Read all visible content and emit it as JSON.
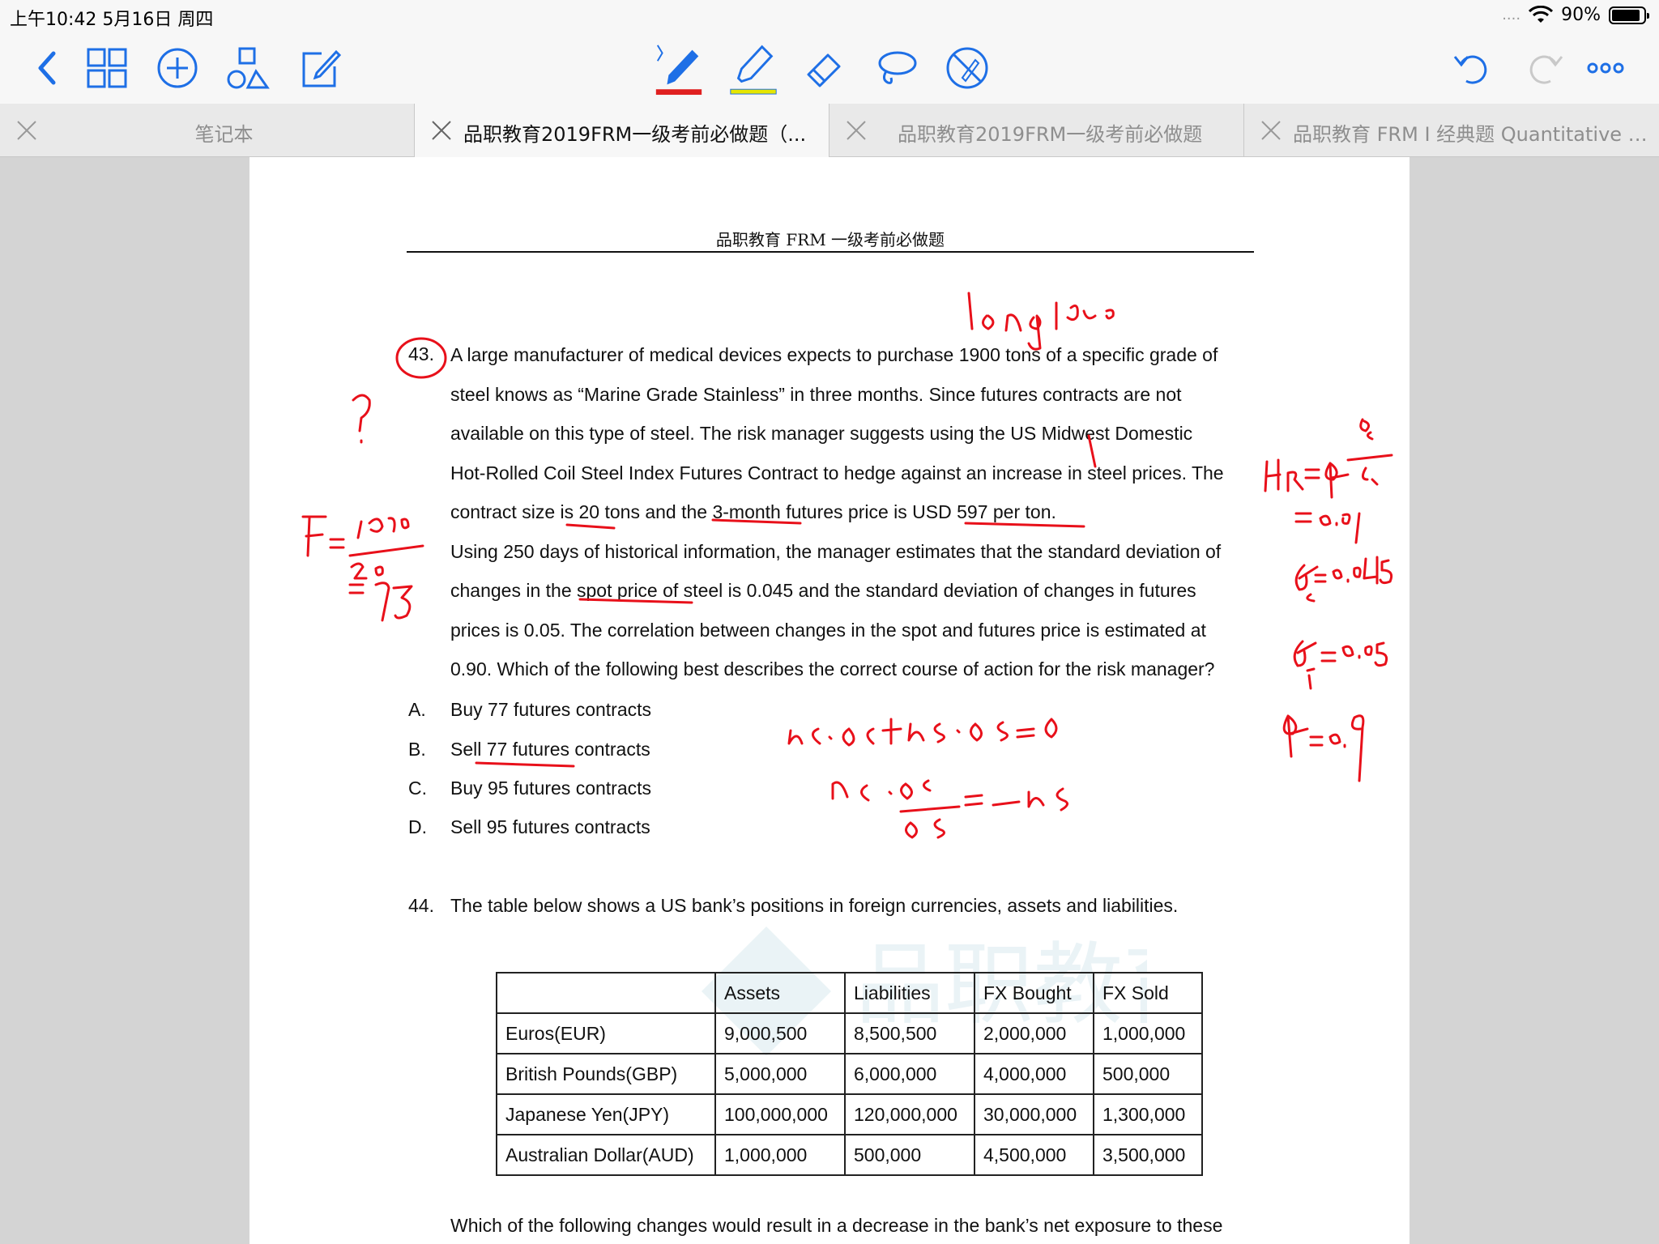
{
  "status": {
    "time": "上午10:42   5月16日 周四",
    "signal_text": "....",
    "battery_pct": "90%",
    "battery_level": 0.9
  },
  "toolbar": {
    "left_icons": [
      "back-chevron-icon",
      "thumbnails-grid-icon",
      "add-circle-icon",
      "shapes-icon",
      "compose-icon"
    ],
    "tool_icons": [
      "pen-tool-icon",
      "highlighter-tool-icon",
      "eraser-tool-icon",
      "lasso-tool-icon",
      "laser-disabled-icon"
    ],
    "right_icons": [
      "undo-icon",
      "redo-icon",
      "more-icon"
    ],
    "pen_color": "#e02020",
    "highlighter_color": "#e6e600",
    "accent": "#1e6fe6"
  },
  "tabs": [
    {
      "label": "笔记本",
      "active": false
    },
    {
      "label": "品职教育2019FRM一级考前必做题（...",
      "active": true
    },
    {
      "label": "品职教育2019FRM一级考前必做题",
      "active": false
    },
    {
      "label": "品职教育 FRM I 经典题 Quantitative A...",
      "active": false
    }
  ],
  "document": {
    "header": "品职教育 FRM 一级考前必做题",
    "q43": {
      "number": "43.",
      "lines": [
        "A large manufacturer of medical devices expects to purchase 1900 tons of a specific grade of",
        "steel knows as “Marine Grade Stainless” in three months. Since futures contracts are not",
        "available on this type of steel. The risk manager suggests using the US Midwest Domestic",
        "Hot-Rolled Coil Steel Index Futures Contract to hedge against an increase in steel prices. The",
        "contract size is 20 tons and the 3-month futures price is USD 597 per ton.",
        "Using 250 days of historical information, the manager estimates that the standard deviation of",
        "changes in the spot price of steel is 0.045 and the standard deviation of changes in futures",
        "prices is 0.05. The correlation between changes in the spot and futures price is estimated at",
        "0.90. Which of the following best describes the correct course of action for the risk manager?"
      ],
      "options": [
        {
          "letter": "A.",
          "text": "Buy 77 futures contracts"
        },
        {
          "letter": "B.",
          "text": "Sell 77 futures contracts"
        },
        {
          "letter": "C.",
          "text": "Buy 95 futures contracts"
        },
        {
          "letter": "D.",
          "text": "Sell 95 futures contracts"
        }
      ]
    },
    "q44": {
      "number": "44.",
      "text": "The table below shows a US bank’s positions in foreign currencies, assets and liabilities.",
      "table": {
        "headers": [
          "",
          "Assets",
          "Liabilities",
          "FX Bought",
          "FX Sold"
        ],
        "rows": [
          [
            "Euros(EUR)",
            "9,000,500",
            "8,500,500",
            "2,000,000",
            "1,000,000"
          ],
          [
            "British Pounds(GBP)",
            "5,000,000",
            "6,000,000",
            "4,000,000",
            "500,000"
          ],
          [
            "Japanese Yen(JPY)",
            "100,000,000",
            "120,000,000",
            "30,000,000",
            "1,300,000"
          ],
          [
            "Australian Dollar(AUD)",
            "1,000,000",
            "500,000",
            "4,500,000",
            "3,500,000"
          ]
        ]
      },
      "followup": "Which of the following changes would result in a decrease in the bank’s net exposure to these"
    },
    "watermark_text": "品职教育"
  }
}
